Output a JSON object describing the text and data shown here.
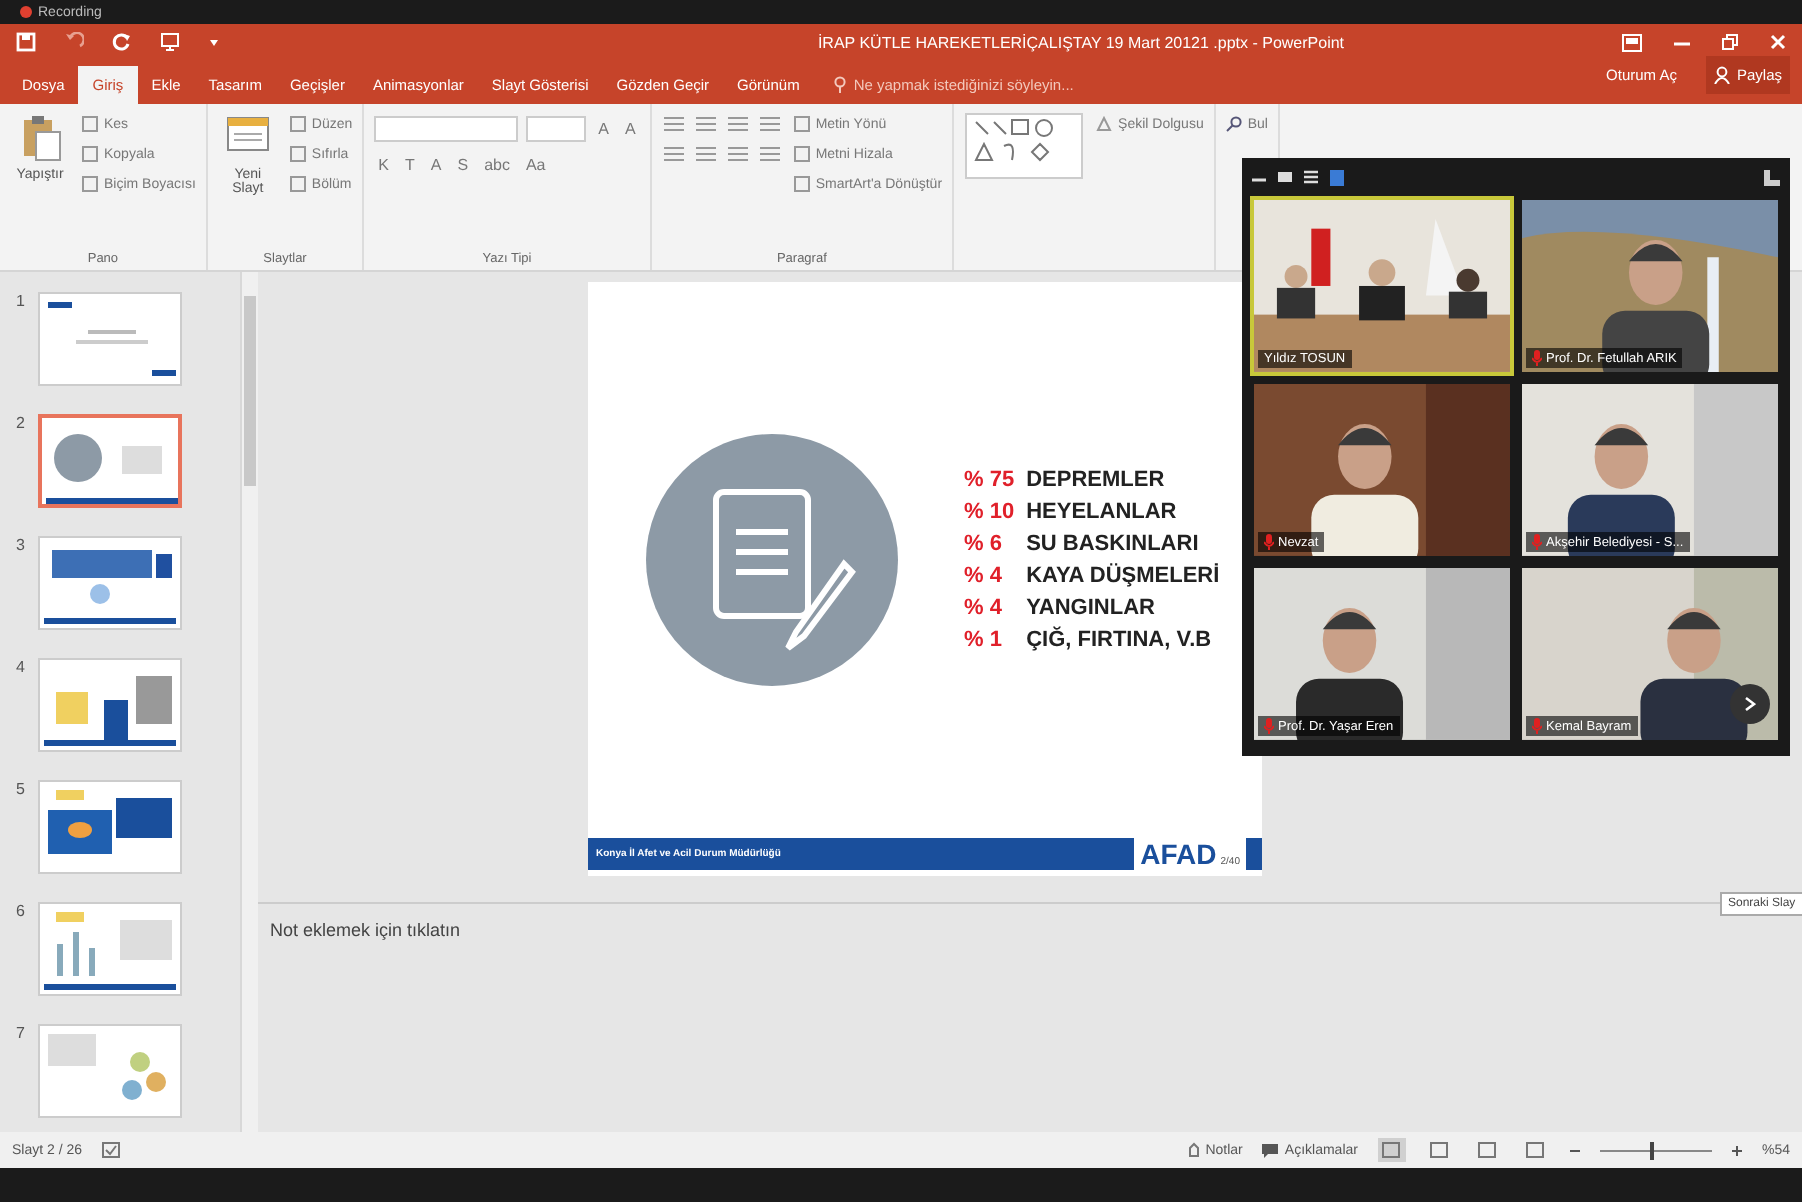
{
  "recording": {
    "label": "Recording"
  },
  "window": {
    "title": "İRAP KÜTLE HAREKETLERİÇALIŞTAY 19 Mart 20121 .pptx - PowerPoint"
  },
  "tell_me": {
    "placeholder": "Ne yapmak istediğinizi söyleyin..."
  },
  "account": {
    "sign_in": "Oturum Aç",
    "share": "Paylaş"
  },
  "tabs": [
    {
      "label": "Dosya",
      "selected": false
    },
    {
      "label": "Giriş",
      "selected": true
    },
    {
      "label": "Ekle",
      "selected": false
    },
    {
      "label": "Tasarım",
      "selected": false
    },
    {
      "label": "Geçişler",
      "selected": false
    },
    {
      "label": "Animasyonlar",
      "selected": false
    },
    {
      "label": "Slayt Gösterisi",
      "selected": false
    },
    {
      "label": "Gözden Geçir",
      "selected": false
    },
    {
      "label": "Görünüm",
      "selected": false
    }
  ],
  "ribbon": [
    {
      "kind": "clipboard",
      "title": "Pano",
      "big": "Yapıştır",
      "items": [
        "Kes",
        "Kopyala",
        "Biçim Boyacısı"
      ]
    },
    {
      "kind": "slides",
      "title": "Slaytlar",
      "big": "Yeni Slayt",
      "items": [
        "Düzen",
        "Sıfırla",
        "Bölüm"
      ]
    },
    {
      "kind": "font",
      "title": "Yazı Tipi",
      "size_items": [
        "A",
        "A"
      ],
      "items": [
        "K",
        "T",
        "A",
        "S",
        "abc",
        "Aa"
      ]
    },
    {
      "kind": "paragraph",
      "title": "Paragraf",
      "items": [
        "Metin Yönü",
        "Metni Hizala",
        "SmartArt'a Dönüştür"
      ]
    },
    {
      "kind": "drawing",
      "items": [
        "Şekil Dolgusu"
      ]
    },
    {
      "kind": "editing",
      "items": [
        "Bul"
      ]
    }
  ],
  "thumbnails": [
    {
      "number": "1",
      "selected": false
    },
    {
      "number": "2",
      "selected": true
    },
    {
      "number": "3",
      "selected": false
    },
    {
      "number": "4",
      "selected": false
    },
    {
      "number": "5",
      "selected": false
    },
    {
      "number": "6",
      "selected": false
    },
    {
      "number": "7",
      "selected": false
    }
  ],
  "slide": {
    "items": [
      {
        "percent": "% 75",
        "label": "DEPREMLER"
      },
      {
        "percent": "% 10",
        "label": "HEYELANLAR"
      },
      {
        "percent": "% 6",
        "label": "SU BASKINLARI"
      },
      {
        "percent": "% 4",
        "label": "KAYA DÜŞMELERİ"
      },
      {
        "percent": "% 4",
        "label": "YANGINLAR"
      },
      {
        "percent": "% 1",
        "label": "ÇIĞ, FIRTINA, V.B"
      }
    ],
    "footer": "Konya İl Afet ve Acil Durum Müdürlüğü",
    "logo": "AFAD",
    "page": "2/40"
  },
  "notes": {
    "placeholder": "Not eklemek için tıklatın"
  },
  "tooltip": "Sonraki Slay",
  "status_bar": {
    "slide_counter": "Slayt 2 / 26",
    "notes": "Notlar",
    "comments": "Açıklamalar",
    "zoom": {
      "level": 0.45,
      "reading": "%54"
    }
  },
  "meeting": {
    "tiles": [
      {
        "name": "Yıldız TOSUN",
        "active": true,
        "muted": false
      },
      {
        "name": "Prof. Dr. Fetullah ARIK",
        "active": false,
        "muted": true
      },
      {
        "name": "Nevzat",
        "active": false,
        "muted": true
      },
      {
        "name": "Akşehir Belediyesi - S...",
        "active": false,
        "muted": true
      },
      {
        "name": "Prof. Dr. Yaşar Eren",
        "active": false,
        "muted": true
      },
      {
        "name": "Kemal Bayram",
        "active": false,
        "muted": true
      }
    ]
  }
}
